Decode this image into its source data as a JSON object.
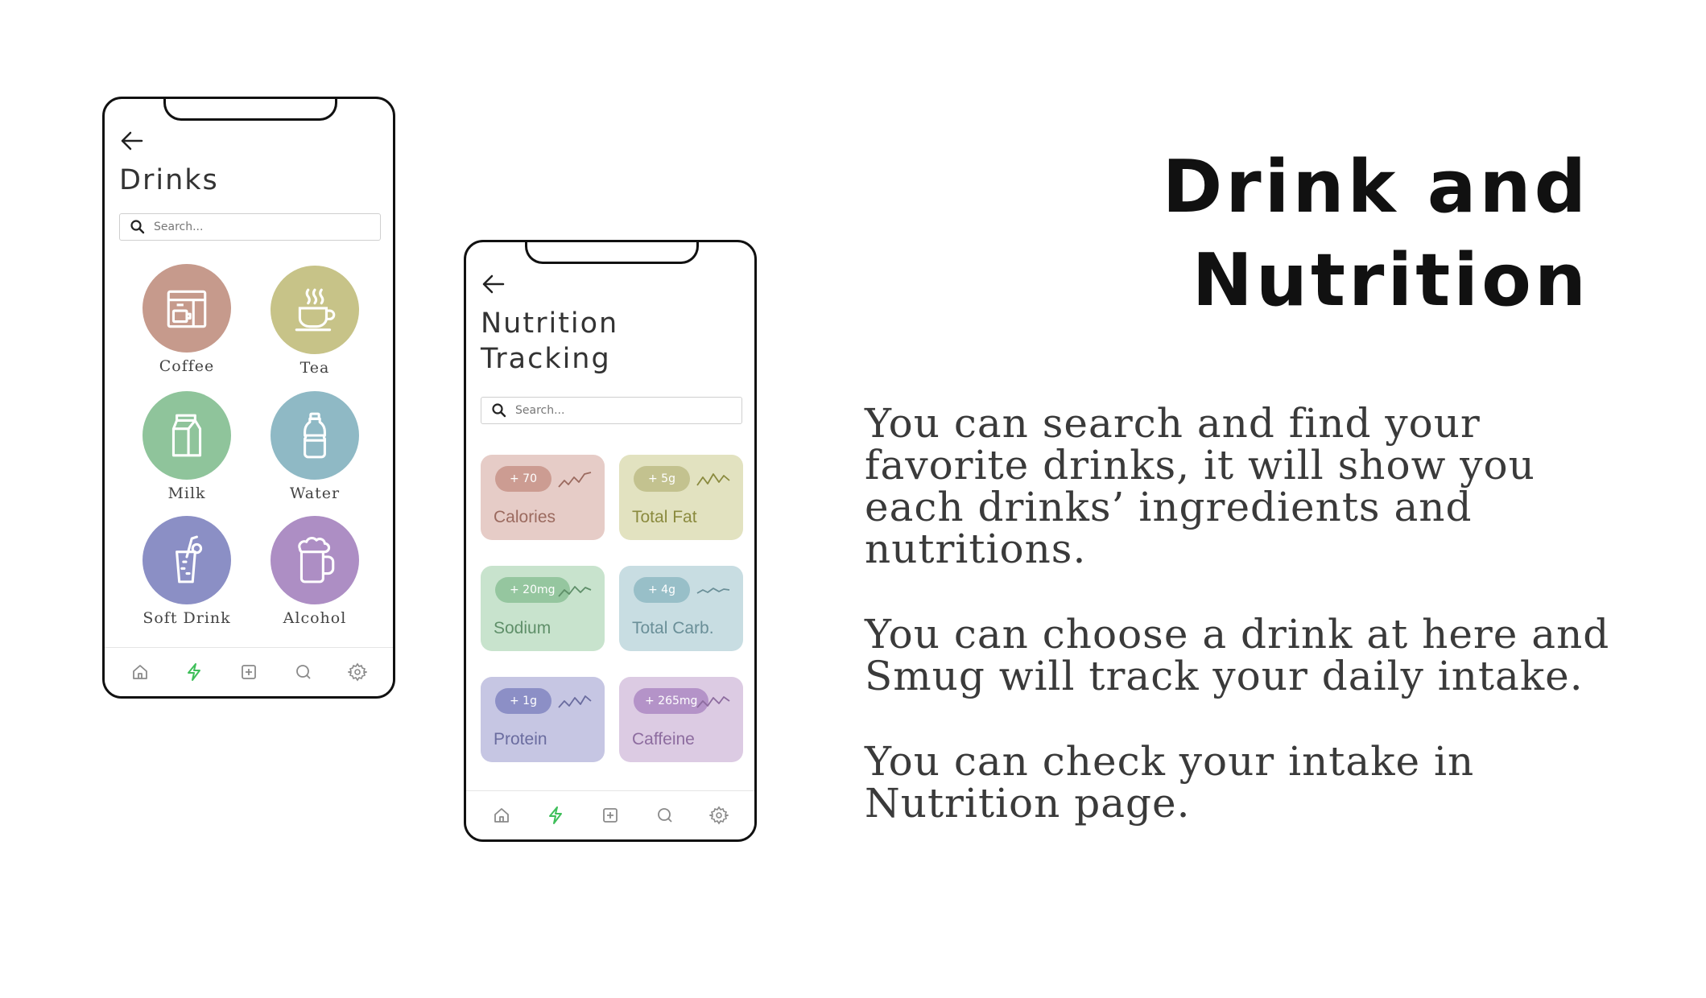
{
  "drinks_screen": {
    "title": "Drinks",
    "search_placeholder": "Search...",
    "categories": [
      {
        "label": "Coffee",
        "color": "#c69a8c",
        "icon": "coffee-machine-icon"
      },
      {
        "label": "Tea",
        "color": "#c7c388",
        "icon": "tea-cup-icon"
      },
      {
        "label": "Milk",
        "color": "#8fc49b",
        "icon": "milk-carton-icon"
      },
      {
        "label": "Water",
        "color": "#8fb9c5",
        "icon": "water-bottle-icon"
      },
      {
        "label": "Soft Drink",
        "color": "#8b8fc5",
        "icon": "soft-drink-icon"
      },
      {
        "label": "Alcohol",
        "color": "#ad8ec4",
        "icon": "beer-mug-icon"
      }
    ]
  },
  "nutrition_screen": {
    "title_line1": "Nutrition",
    "title_line2": "Tracking",
    "search_placeholder": "Search...",
    "cards": [
      {
        "label": "Calories",
        "delta": "+ 70",
        "bg": "#e6ccc7",
        "pill": "#cc9c92",
        "text": "#9b6a5f"
      },
      {
        "label": "Total Fat",
        "delta": "+ 5g",
        "bg": "#e2e2c0",
        "pill": "#c3c28f",
        "text": "#8a8a3e"
      },
      {
        "label": "Sodium",
        "delta": "+ 20mg",
        "bg": "#c8e3cd",
        "pill": "#95c69f",
        "text": "#5f8f69"
      },
      {
        "label": "Total Carb.",
        "delta": "+ 4g",
        "bg": "#c8dde2",
        "pill": "#98bfc8",
        "text": "#6a8f98"
      },
      {
        "label": "Protein",
        "delta": "+ 1g",
        "bg": "#c6c6e3",
        "pill": "#8c8fc6",
        "text": "#6a6c9f"
      },
      {
        "label": "Caffeine",
        "delta": "+ 265mg",
        "bg": "#dccbe3",
        "pill": "#b493c8",
        "text": "#8d6c9f"
      }
    ]
  },
  "tabbar": {
    "icons": [
      "home-icon",
      "bolt-icon",
      "add-square-icon",
      "search-icon",
      "settings-gear-icon"
    ],
    "active_color": "#3fbf5a",
    "inactive_color": "#8a8a8a"
  },
  "heading": {
    "line1": "Drink and",
    "line2": "Nutrition"
  },
  "paragraphs": [
    "You can search and find your\nfavorite drinks, it will show you\neach drinks’ ingredients and\nnutritions.",
    "You can choose a drink at here and\nSmug will track your daily intake.",
    "You can check your intake in\nNutrition page."
  ]
}
